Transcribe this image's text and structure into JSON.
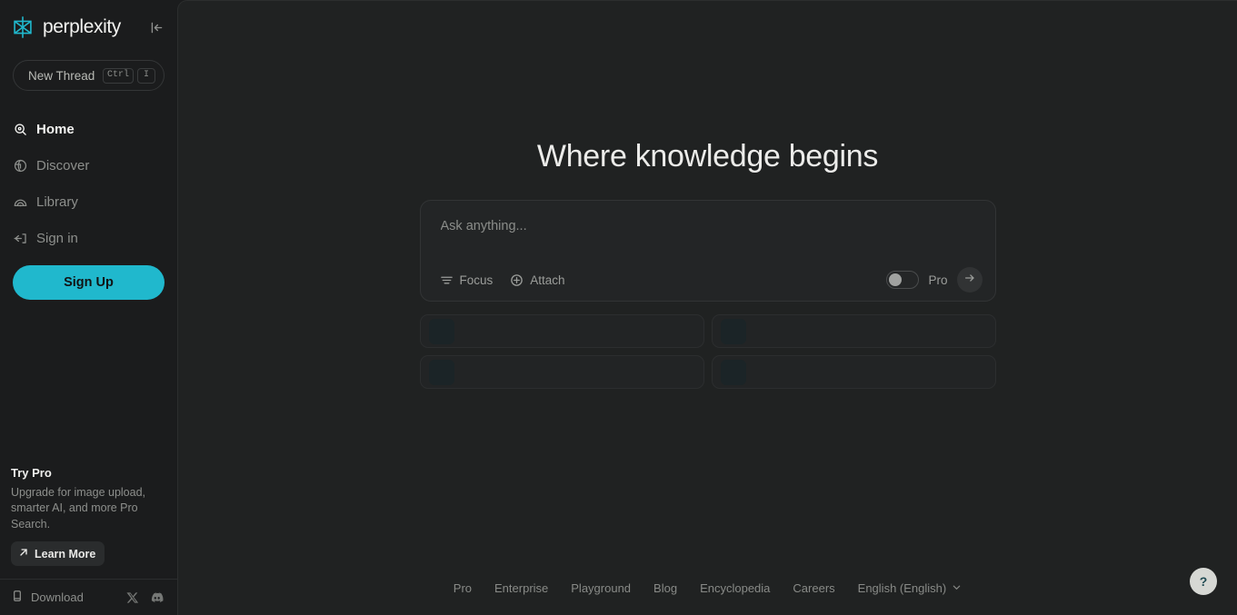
{
  "brand": {
    "name": "perplexity",
    "accent": "#20b8cd",
    "logo_icon": "perplexity-logo-mark"
  },
  "sidebar": {
    "collapse_icon": "collapse-sidebar-icon",
    "new_thread": {
      "label": "New Thread",
      "key_modifier": "Ctrl",
      "key_letter": "I"
    },
    "items": [
      {
        "label": "Home",
        "icon": "search-home-icon",
        "active": true
      },
      {
        "label": "Discover",
        "icon": "globe-discover-icon",
        "active": false
      },
      {
        "label": "Library",
        "icon": "library-arc-icon",
        "active": false
      },
      {
        "label": "Sign in",
        "icon": "sign-in-arrow-icon",
        "active": false
      }
    ],
    "signup_label": "Sign Up",
    "try_pro": {
      "title": "Try Pro",
      "description": "Upgrade for image upload, smarter AI, and more Pro Search.",
      "cta_label": "Learn More",
      "cta_icon": "arrow-up-right-icon"
    },
    "footer": {
      "download_label": "Download",
      "download_icon": "mobile-device-icon",
      "social": [
        {
          "name": "x-twitter-icon"
        },
        {
          "name": "discord-icon"
        }
      ]
    }
  },
  "main": {
    "hero_title": "Where knowledge begins",
    "composer": {
      "placeholder": "Ask anything...",
      "value": "",
      "focus_label": "Focus",
      "focus_icon": "focus-sliders-icon",
      "attach_label": "Attach",
      "attach_icon": "plus-circle-icon",
      "pro_label": "Pro",
      "pro_enabled": false,
      "submit_icon": "arrow-right-icon"
    },
    "suggestion_cards": [
      {
        "thumb": "placeholder-thumb",
        "text": ""
      },
      {
        "thumb": "placeholder-thumb",
        "text": ""
      },
      {
        "thumb": "placeholder-thumb",
        "text": ""
      },
      {
        "thumb": "placeholder-thumb",
        "text": ""
      }
    ]
  },
  "bottom": {
    "links": [
      {
        "label": "Pro"
      },
      {
        "label": "Enterprise"
      },
      {
        "label": "Playground"
      },
      {
        "label": "Blog"
      },
      {
        "label": "Encyclopedia"
      },
      {
        "label": "Careers"
      }
    ],
    "language": "English (English)",
    "language_icon": "chevron-down-icon",
    "help_label": "?"
  }
}
